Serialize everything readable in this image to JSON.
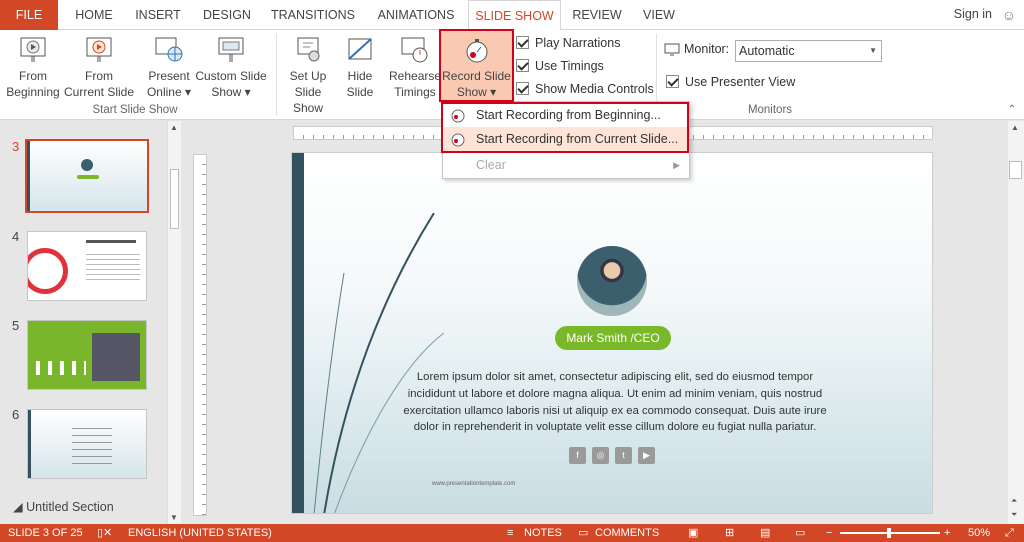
{
  "tabs": {
    "file": "FILE",
    "home": "HOME",
    "insert": "INSERT",
    "design": "DESIGN",
    "transitions": "TRANSITIONS",
    "animations": "ANIMATIONS",
    "slide_show": "SLIDE SHOW",
    "review": "REVIEW",
    "view": "VIEW"
  },
  "account": {
    "sign_in": "Sign in"
  },
  "ribbon": {
    "start_group": "Start Slide Show",
    "from_beginning": "From\nBeginning",
    "from_current": "From\nCurrent Slide",
    "present_online": "Present\nOnline ▾",
    "custom_show": "Custom Slide\nShow ▾",
    "set_up": "Set Up\nSlide Show",
    "hide_slide": "Hide\nSlide",
    "rehearse": "Rehearse\nTimings",
    "record": "Record Slide\nShow ▾",
    "play_narrations": "Play Narrations",
    "use_timings": "Use Timings",
    "show_media": "Show Media Controls",
    "monitors_group": "Monitors",
    "monitor_label": "Monitor:",
    "monitor_value": "Automatic",
    "presenter_view": "Use Presenter View"
  },
  "record_menu": {
    "item1": "Start Recording from Beginning...",
    "item2": "Start Recording from Current Slide...",
    "item3": "Clear"
  },
  "thumbnails": {
    "n3": "3",
    "n4": "4",
    "n5": "5",
    "n6": "6"
  },
  "section": "Untitled Section",
  "slide": {
    "name": "Mark Smith /CEO",
    "body": "Lorem ipsum dolor sit amet, consectetur adipiscing elit, sed do eiusmod tempor incididunt ut labore et dolore magna aliqua. Ut enim ad minim veniam, quis nostrud exercitation ullamco laboris nisi ut aliquip ex ea commodo consequat. Duis aute irure dolor in reprehenderit in voluptate velit esse cillum dolore eu fugiat nulla pariatur.",
    "website": "www.presentationtemplate.com"
  },
  "status": {
    "slide_of": "SLIDE 3 OF 25",
    "language": "ENGLISH (UNITED STATES)",
    "notes": "NOTES",
    "comments": "COMMENTS",
    "zoom": "50%"
  },
  "colors": {
    "accent": "#d24726",
    "green": "#79b829",
    "highlight": "#d0021b"
  }
}
